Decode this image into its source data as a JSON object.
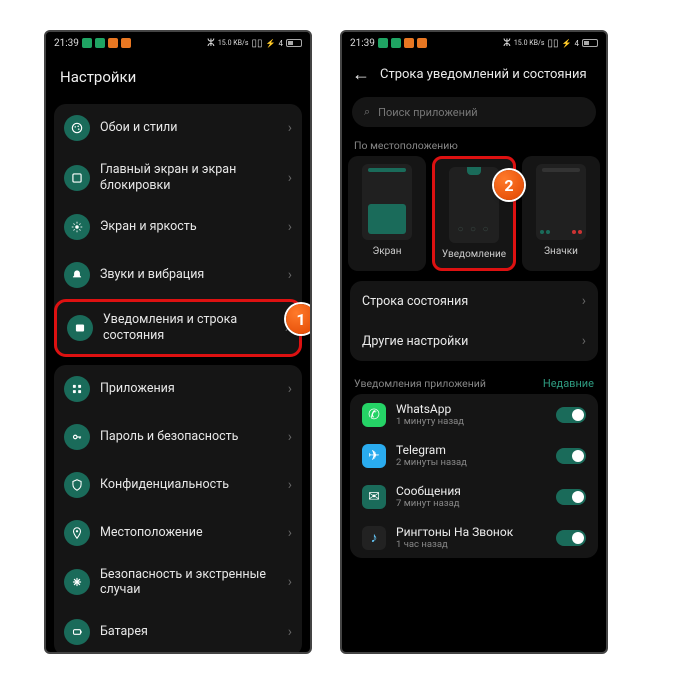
{
  "statusbar": {
    "time": "21:39",
    "net": "15.0 KB/s",
    "battery": "4"
  },
  "screen1": {
    "title": "Настройки",
    "group1": [
      {
        "label": "Обои и стили"
      },
      {
        "label": "Главный экран и экран блокировки"
      },
      {
        "label": "Экран и яркость"
      },
      {
        "label": "Звуки и вибрация"
      },
      {
        "label": "Уведомления и строка состояния"
      }
    ],
    "group2": [
      {
        "label": "Приложения"
      },
      {
        "label": "Пароль и безопасность"
      },
      {
        "label": "Конфиденциальность"
      },
      {
        "label": "Местоположение"
      },
      {
        "label": "Безопасность и экстренные случаи"
      },
      {
        "label": "Батарея"
      }
    ]
  },
  "screen2": {
    "title": "Строка уведомлений и состояния",
    "search_placeholder": "Поиск приложений",
    "location_section": "По местоположению",
    "cards": [
      {
        "label": "Экран"
      },
      {
        "label": "Уведомление"
      },
      {
        "label": "Значки"
      }
    ],
    "rows": [
      {
        "label": "Строка состояния"
      },
      {
        "label": "Другие настройки"
      }
    ],
    "apps_header": "Уведомления приложений",
    "apps_recent": "Недавние",
    "apps": [
      {
        "name": "WhatsApp",
        "time": "1 минуту назад",
        "color": "#25D366",
        "glyph": "✆"
      },
      {
        "name": "Telegram",
        "time": "2 минуты назад",
        "color": "#2AABEE",
        "glyph": "✈"
      },
      {
        "name": "Сообщения",
        "time": "7 минут назад",
        "color": "#1a6b5a",
        "glyph": "✉"
      },
      {
        "name": "Рингтоны На Звонок",
        "time": "1 час назад",
        "color": "#222",
        "glyph": "♪"
      }
    ]
  },
  "badges": {
    "b1": "1",
    "b2": "2"
  }
}
